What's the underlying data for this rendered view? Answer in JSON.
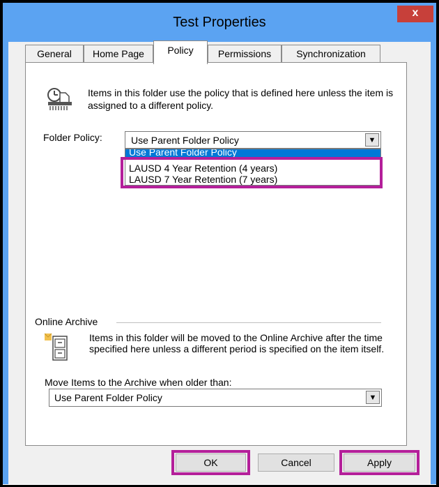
{
  "window": {
    "title": "Test Properties",
    "close_label": "x"
  },
  "tabs": [
    {
      "label": "General"
    },
    {
      "label": "Home Page"
    },
    {
      "label": "Policy",
      "active": true
    },
    {
      "label": "Permissions"
    },
    {
      "label": "Synchronization"
    }
  ],
  "policy": {
    "description": "Items in this folder use the policy that is defined here unless the item is assigned to a different policy.",
    "folder_policy_label": "Folder Policy:",
    "selected_value": "Use Parent Folder Policy",
    "options": [
      "Use Parent Folder Policy",
      "LAUSD 4 Year Retention (4 years)",
      "LAUSD 7 Year Retention (7 years)"
    ]
  },
  "archive": {
    "header": "Online Archive",
    "description": "Items in this folder will be moved to the Online Archive after the time specified here unless a different period is specified on the item itself.",
    "move_label": "Move Items to the Archive when older than:",
    "selected_value": "Use Parent Folder Policy"
  },
  "buttons": {
    "ok": "OK",
    "cancel": "Cancel",
    "apply": "Apply"
  },
  "colors": {
    "titlebar": "#5ba3f2",
    "close_button": "#c7403a",
    "highlight": "#b41f9a",
    "selection": "#0078d7"
  },
  "icons": {
    "policy": "clock-document-icon",
    "archive": "archive-cabinet-icon",
    "dropdown": "chevron-down-icon"
  }
}
